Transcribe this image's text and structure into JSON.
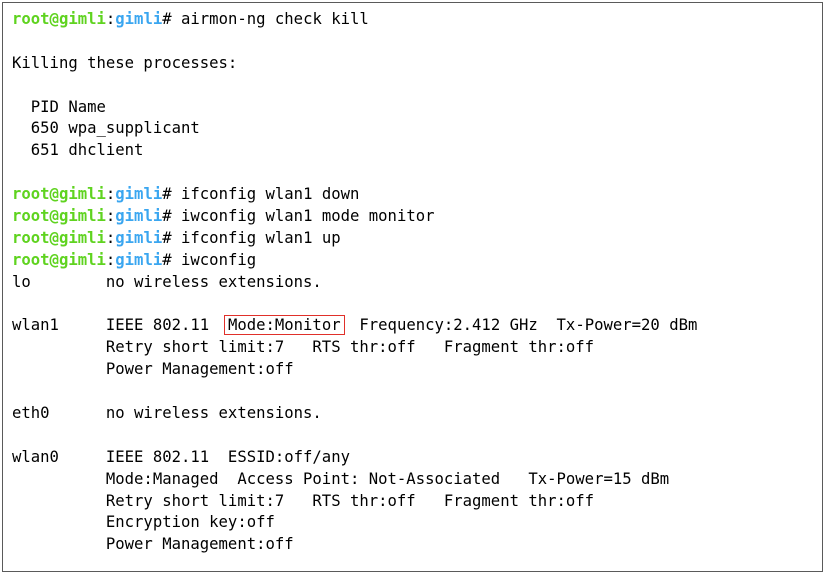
{
  "colors": {
    "user": "#5fd31f",
    "host": "#3aa6f0",
    "highlight_box": "#e0302a"
  },
  "prompt": {
    "user_host": "root@gimli",
    "colon": ":",
    "cwd": "gimli",
    "symbol": "# "
  },
  "commands": [
    "airmon-ng check kill",
    "ifconfig wlan1 down",
    "iwconfig wlan1 mode monitor",
    "ifconfig wlan1 up",
    "iwconfig"
  ],
  "killing": {
    "heading": "Killing these processes:",
    "header": "  PID Name",
    "rows": [
      "  650 wpa_supplicant",
      "  651 dhclient"
    ]
  },
  "interfaces": {
    "lo": "lo        no wireless extensions.",
    "wlan1": {
      "prefix": "wlan1     IEEE 802.11  ",
      "mode": "Mode:Monitor",
      "suffix": "  Frequency:2.412 GHz  Tx-Power=20 dBm",
      "line2": "          Retry short limit:7   RTS thr:off   Fragment thr:off",
      "line3": "          Power Management:off"
    },
    "eth0": "eth0      no wireless extensions.",
    "wlan0": [
      "wlan0     IEEE 802.11  ESSID:off/any",
      "          Mode:Managed  Access Point: Not-Associated   Tx-Power=15 dBm",
      "          Retry short limit:7   RTS thr:off   Fragment thr:off",
      "          Encryption key:off",
      "          Power Management:off"
    ]
  }
}
